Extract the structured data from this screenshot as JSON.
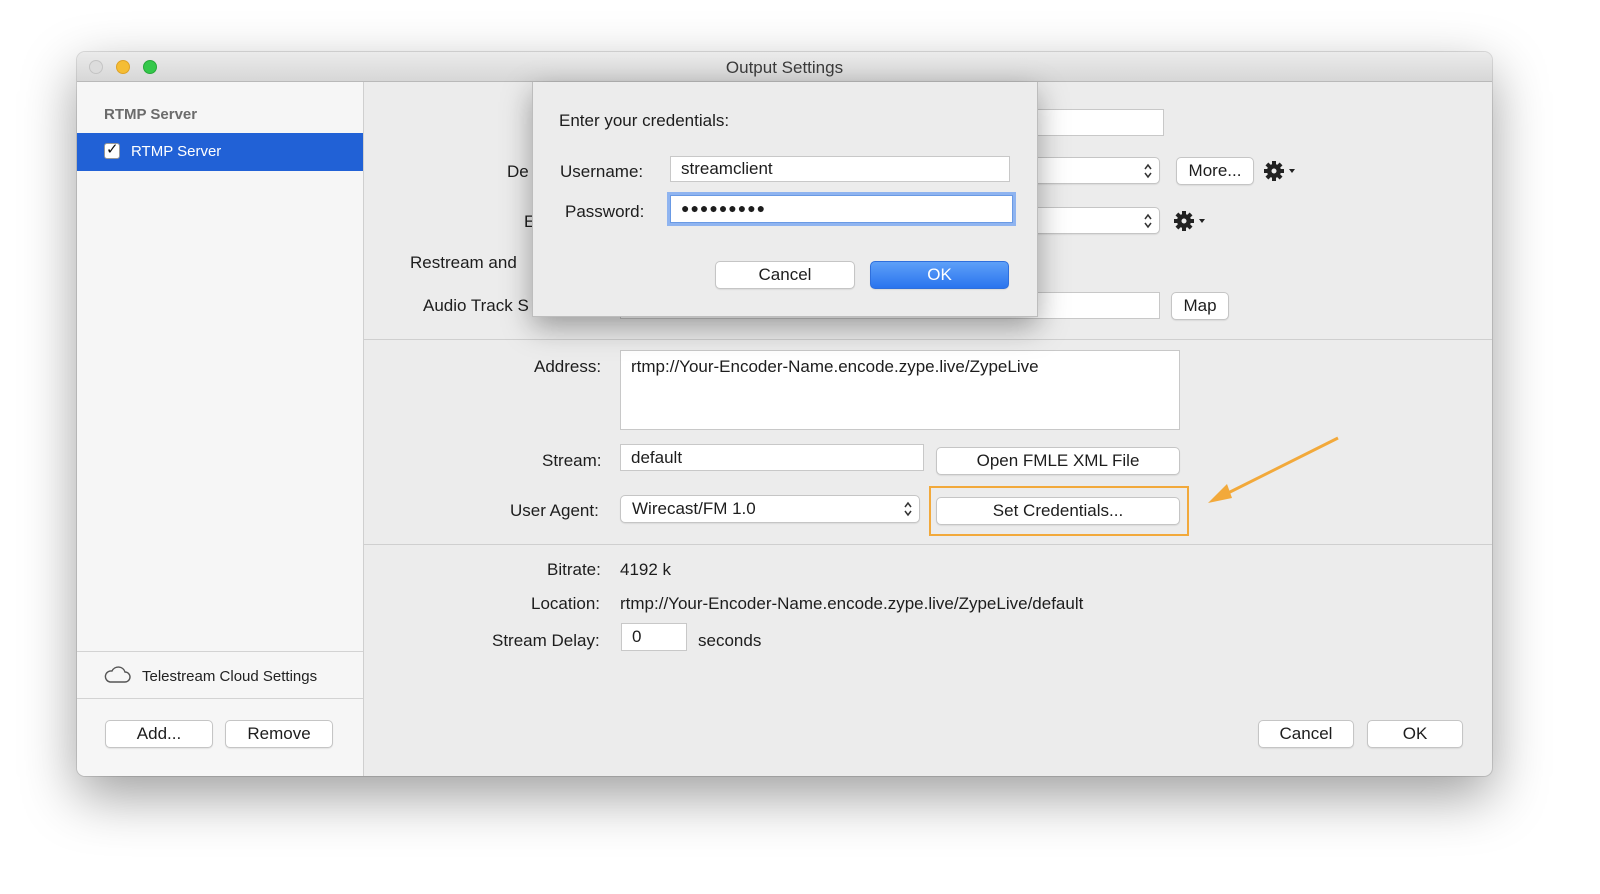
{
  "window": {
    "title": "Output Settings"
  },
  "sidebar": {
    "header": "RTMP Server",
    "items": [
      {
        "label": "RTMP Server",
        "checked": true
      }
    ],
    "cloud_settings_label": "Telestream Cloud Settings",
    "add_label": "Add...",
    "remove_label": "Remove"
  },
  "form": {
    "destination_label_partial": "De",
    "encoding_label_partial": "E",
    "restream_label_partial": "Restream and",
    "audio_track_label_partial": "Audio Track S",
    "more_label": "More...",
    "map_label": "Map",
    "address_label": "Address:",
    "address_value": "rtmp://Your-Encoder-Name.encode.zype.live/ZypeLive",
    "stream_label": "Stream:",
    "stream_value": "default",
    "open_fmle_label": "Open FMLE XML File",
    "user_agent_label": "User Agent:",
    "user_agent_value": "Wirecast/FM 1.0",
    "set_credentials_label": "Set Credentials...",
    "bitrate_label": "Bitrate:",
    "bitrate_value": "4192 k",
    "location_label": "Location:",
    "location_value": "rtmp://Your-Encoder-Name.encode.zype.live/ZypeLive/default",
    "stream_delay_label": "Stream Delay:",
    "stream_delay_value": "0",
    "stream_delay_unit": "seconds",
    "cancel_label": "Cancel",
    "ok_label": "OK"
  },
  "credentials_sheet": {
    "title": "Enter your credentials:",
    "username_label": "Username:",
    "username_value": "streamclient",
    "password_label": "Password:",
    "password_value": "●●●●●●●●●",
    "cancel_label": "Cancel",
    "ok_label": "OK"
  },
  "colors": {
    "selection": "#2161d6",
    "highlight_box": "#f2a93b",
    "arrow": "#f2a93b",
    "primary_button": "#2a74ee"
  }
}
